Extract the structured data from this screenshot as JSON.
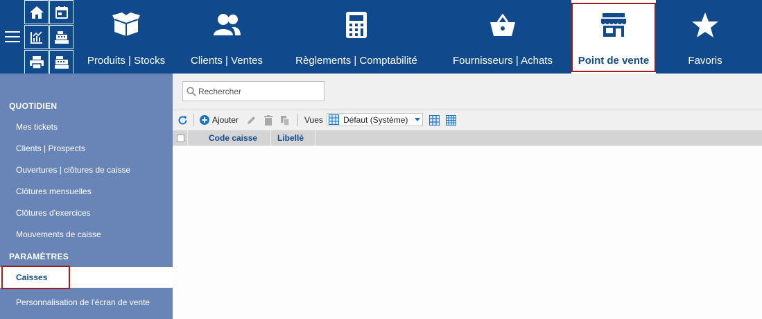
{
  "topbar": {
    "menu_icon": "hamburger-icon",
    "quick_icons": [
      "home-icon",
      "calendar-icon",
      "chart-icon",
      "cash-register-icon",
      "printer-icon",
      "cash-register-icon"
    ],
    "nav": [
      {
        "label": "Produits | Stocks",
        "icon": "box-icon"
      },
      {
        "label": "Clients | Ventes",
        "icon": "users-icon"
      },
      {
        "label": "Règlements | Comptabilité",
        "icon": "calculator-icon"
      },
      {
        "label": "Fournisseurs | Achats",
        "icon": "basket-icon"
      },
      {
        "label": "Point de vente",
        "icon": "store-icon",
        "active": true
      },
      {
        "label": "Favoris",
        "icon": "star-icon"
      }
    ]
  },
  "sidebar": {
    "section1": "QUOTIDIEN",
    "items1": [
      "Mes tickets",
      "Clients | Prospects",
      "Ouvertures | clôtures de caisse",
      "Clôtures mensuelles",
      "Clôtures d'exercices",
      "Mouvements de caisse"
    ],
    "section2": "PARAMÈTRES",
    "items2": [
      "Caisses",
      "Personnalisation de l'écran de vente"
    ]
  },
  "main": {
    "search_placeholder": "Rechercher",
    "toolbar": {
      "add_label": "Ajouter",
      "views_label": "Vues",
      "view_selected": "Défaut (Système)"
    },
    "table": {
      "columns": [
        "Code caisse",
        "Libellé"
      ],
      "rows": []
    }
  },
  "colors": {
    "nav_background": "#104a8c",
    "sidebar_background": "#6985b8",
    "highlight_frame": "#a31c1c",
    "header_text": "#104a8c",
    "add_icon": "#1a73c9"
  }
}
